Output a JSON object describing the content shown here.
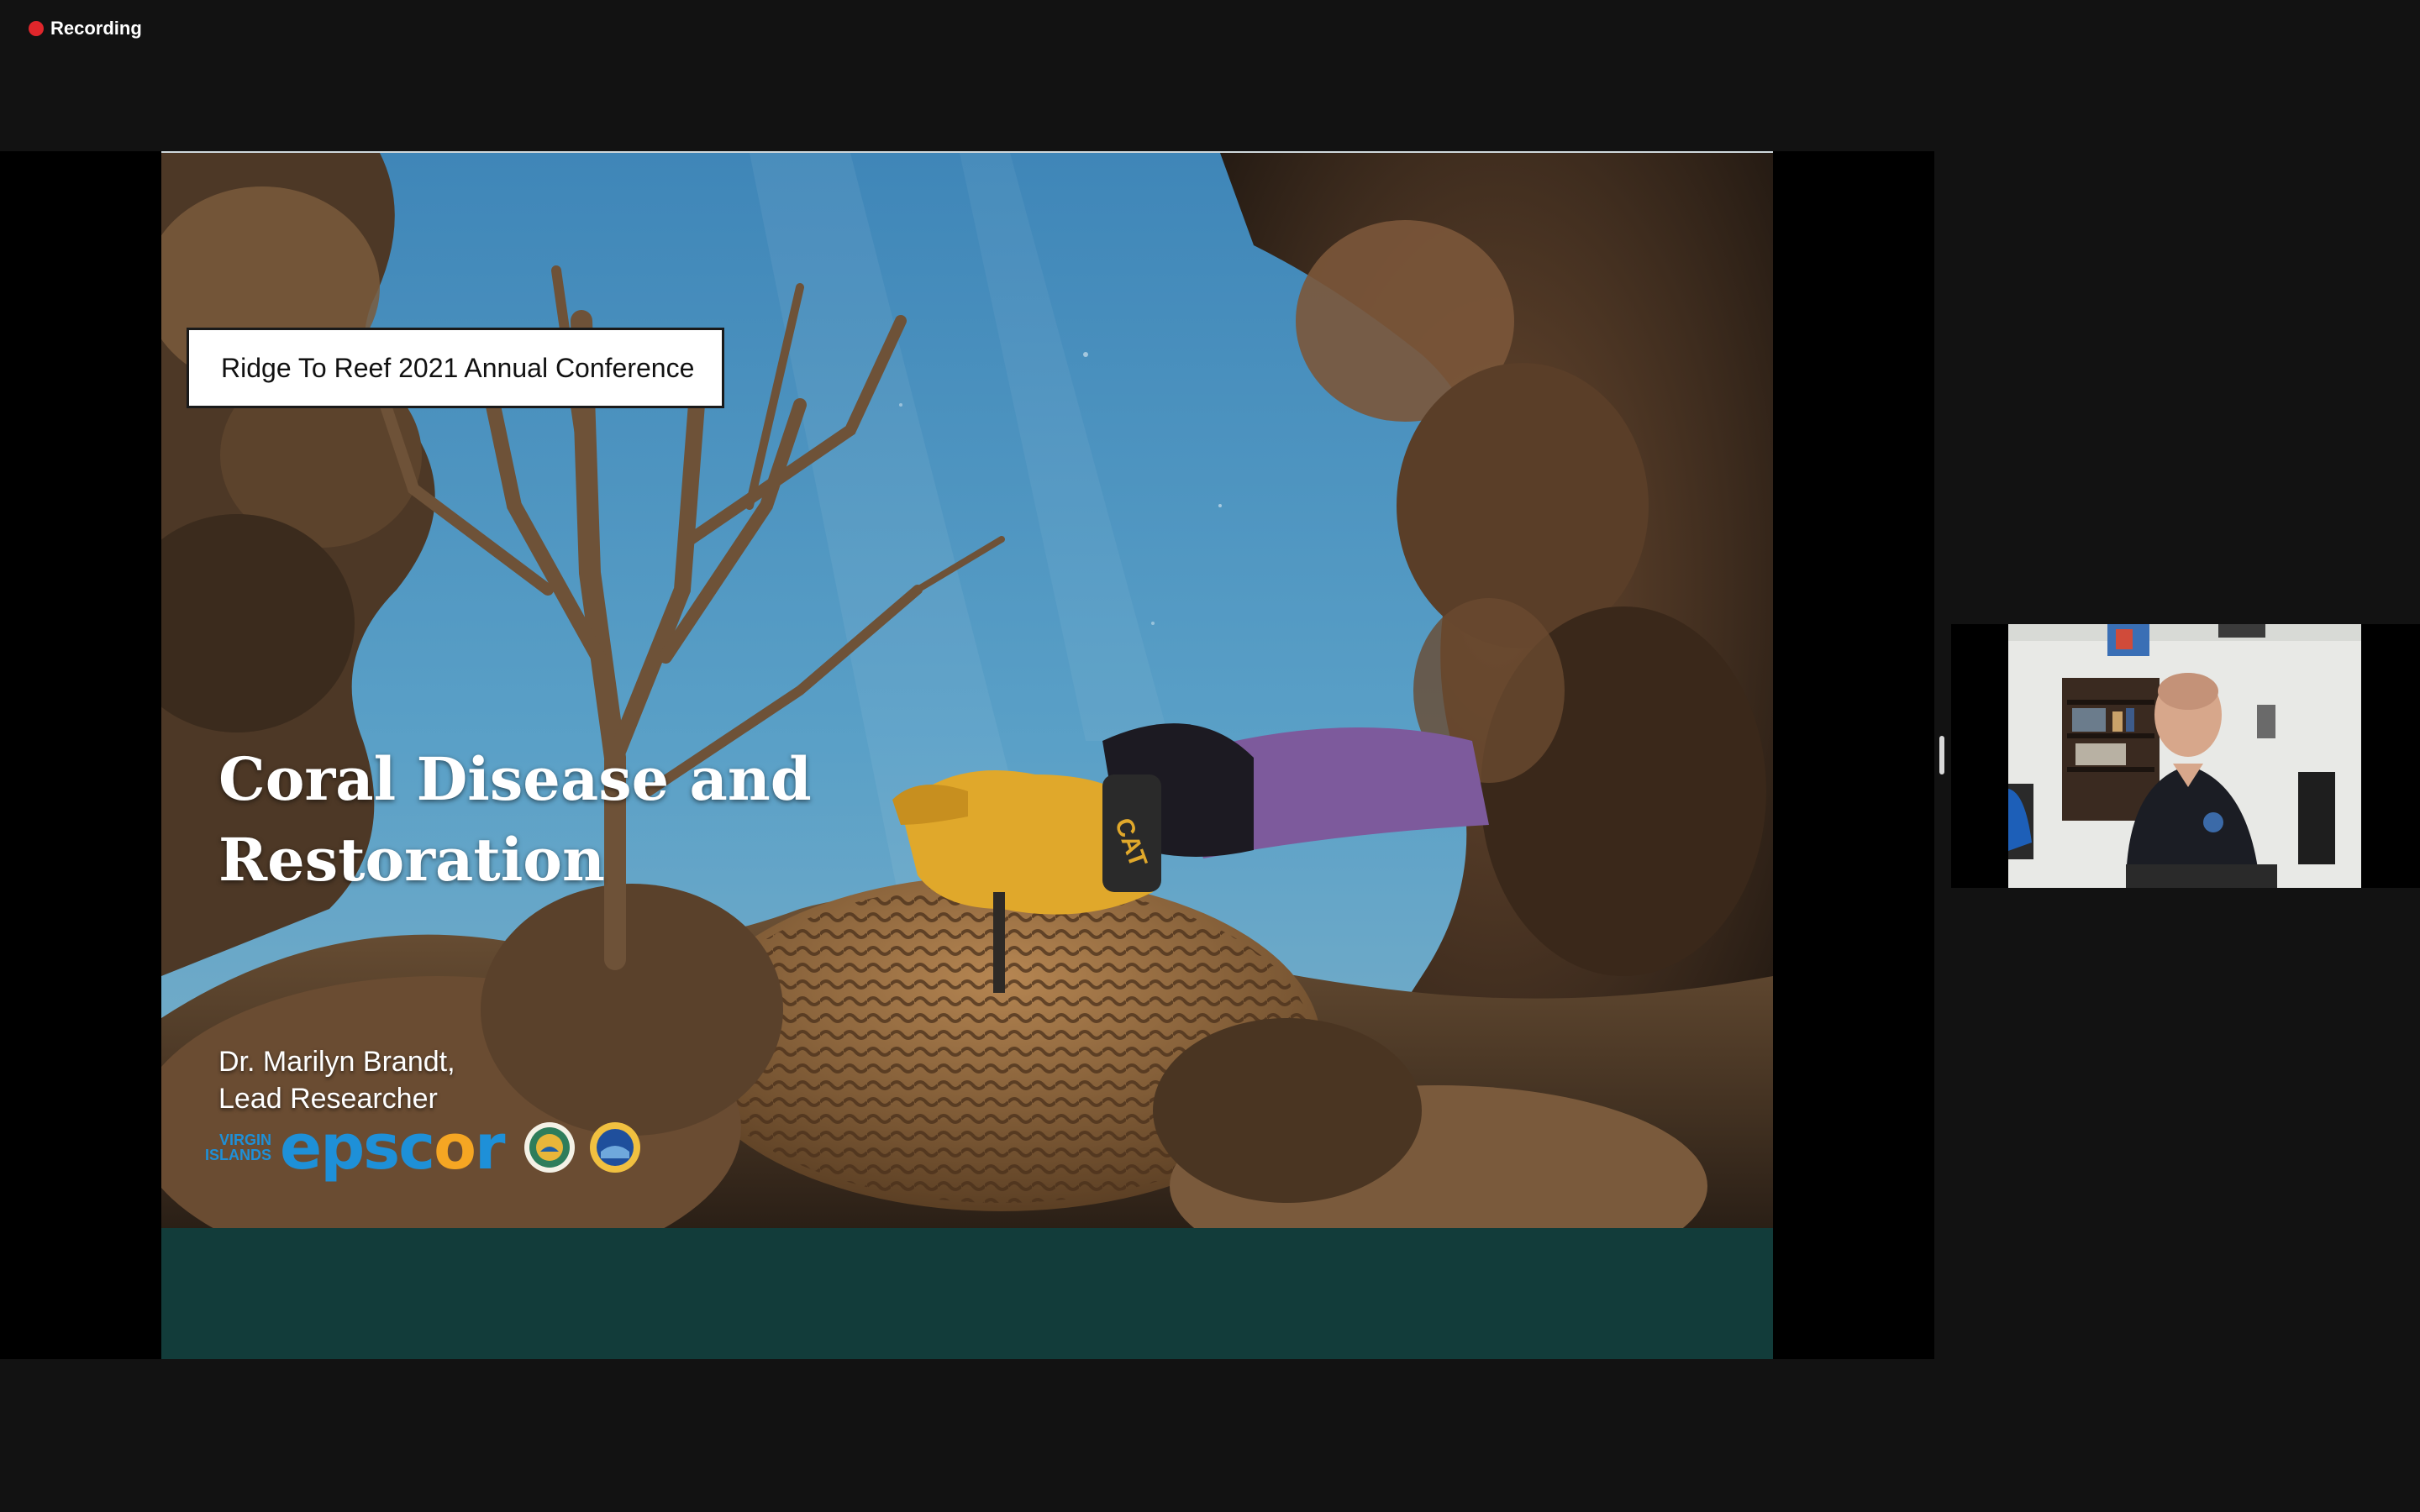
{
  "recording": {
    "label": "Recording",
    "dot_color": "#e0262b"
  },
  "slide": {
    "conference_label": "Ridge To Reef 2021 Annual Conference",
    "title_line1": "Coral Disease and",
    "title_line2": "Restoration",
    "author_line1": "Dr. Marilyn Brandt,",
    "author_line2": "Lead Researcher",
    "band_color": "#123c3a",
    "logos": {
      "vi_line1": "VIRGIN",
      "vi_line2": "ISLANDS",
      "epscor_pre": "epsc",
      "epscor_o": "o",
      "epscor_post": "r",
      "seal1": "uvi-seal-icon",
      "seal2": "nsf-logo-icon"
    },
    "glove_brand": "CAT"
  },
  "video": {
    "participant": "presenter-video"
  }
}
